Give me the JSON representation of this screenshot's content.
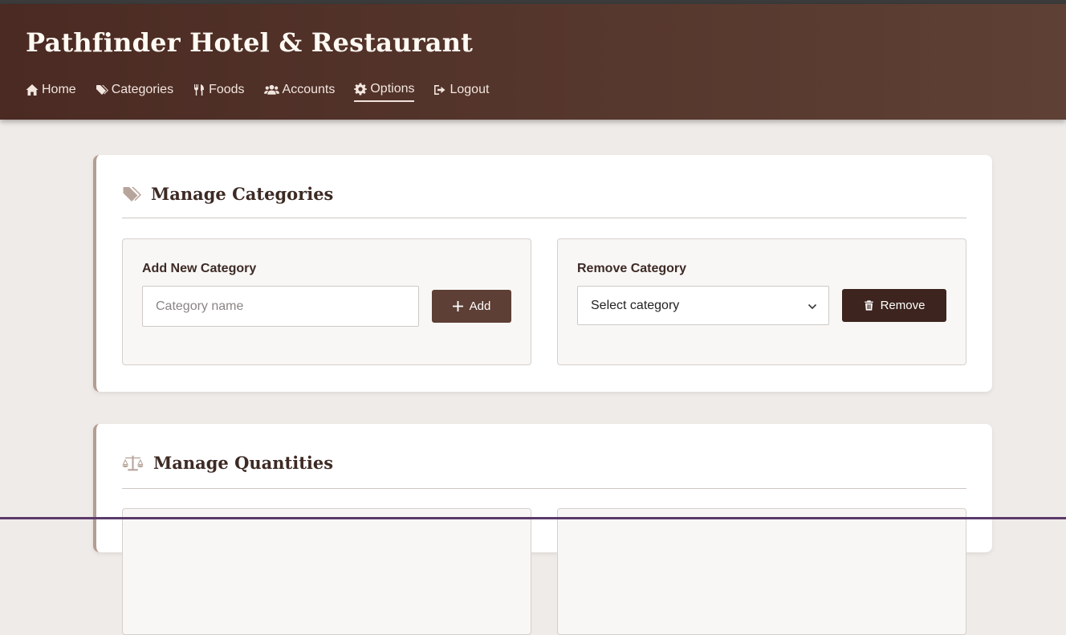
{
  "header": {
    "title": "Pathfinder Hotel & Restaurant",
    "nav": [
      {
        "label": "Home",
        "icon": "home-icon"
      },
      {
        "label": "Categories",
        "icon": "tags-icon"
      },
      {
        "label": "Foods",
        "icon": "utensils-icon"
      },
      {
        "label": "Accounts",
        "icon": "users-icon"
      },
      {
        "label": "Options",
        "icon": "gear-icon",
        "active": true
      },
      {
        "label": "Logout",
        "icon": "logout-icon"
      }
    ]
  },
  "manage_categories": {
    "title": "Manage Categories",
    "icon": "tags-icon",
    "add_panel": {
      "label": "Add New Category",
      "input_placeholder": "Category name",
      "input_value": "",
      "button_label": "Add"
    },
    "remove_panel": {
      "label": "Remove Category",
      "select_value": "Select category",
      "button_label": "Remove"
    }
  },
  "manage_quantities": {
    "title": "Manage Quantities",
    "icon": "scale-icon"
  },
  "colors": {
    "header_bg": "#4a2a22",
    "accent": "#5e3f35",
    "danger_dark": "#3d241e",
    "page_bg": "#efebe8"
  }
}
